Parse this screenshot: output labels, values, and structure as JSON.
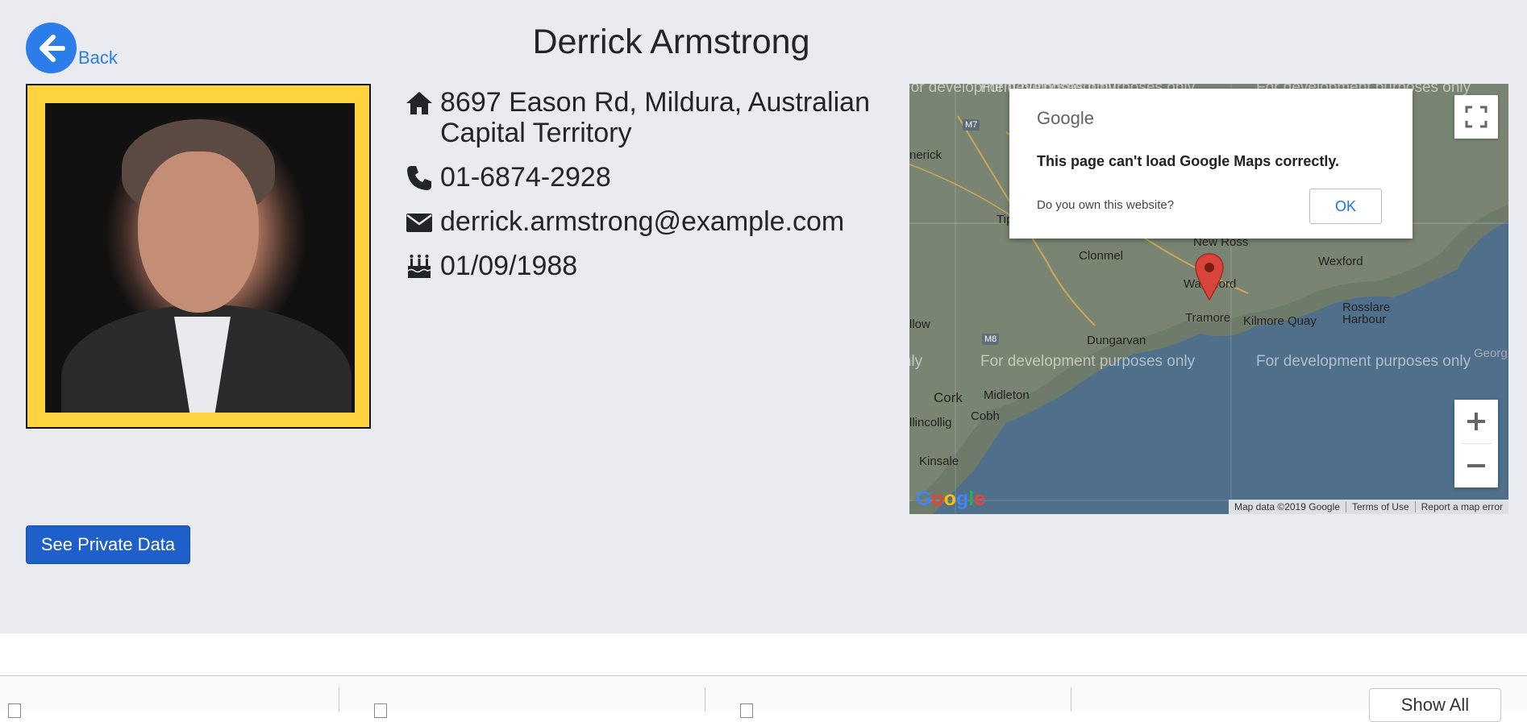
{
  "back": {
    "label": "Back",
    "icon": "arrow-left-icon"
  },
  "profile": {
    "name": "Derrick Armstrong",
    "address": "8697 Eason Rd, Mildura, Australian Capital Territory",
    "phone": "01-6874-2928",
    "email": "derrick.armstrong@example.com",
    "birthday": "01/09/1988"
  },
  "map": {
    "watermark": "For development purposes only",
    "dialog": {
      "logo": "Google",
      "message": "This page can't load Google Maps correctly.",
      "question": "Do you own this website?",
      "ok": "OK"
    },
    "places": [
      "Clonmel",
      "New Ross",
      "Wexford",
      "Waterford",
      "Tramore",
      "Kilmore Quay",
      "Rosslare Harbour",
      "Dungarvan",
      "Cork",
      "Midleton",
      "Cobh",
      "Kinsale",
      "Tipp",
      "nerick",
      "llow",
      "llincollig",
      "Georg"
    ],
    "roads": [
      "M7",
      "M8"
    ],
    "footer": {
      "data": "Map data ©2019 Google",
      "terms": "Terms of Use",
      "report": "Report a map error"
    },
    "google_logo": "Google",
    "colors": {
      "sea": "#4f6f8a",
      "land": "#6e7b6b",
      "marker": "#d9453a"
    }
  },
  "actions": {
    "see_private": "See Private Data"
  },
  "downloads": {
    "show_all": "Show All"
  },
  "colors": {
    "accent": "#2b7de9",
    "frame": "#fdd43f",
    "button": "#1f5fca",
    "background": "#e9ebf0"
  }
}
